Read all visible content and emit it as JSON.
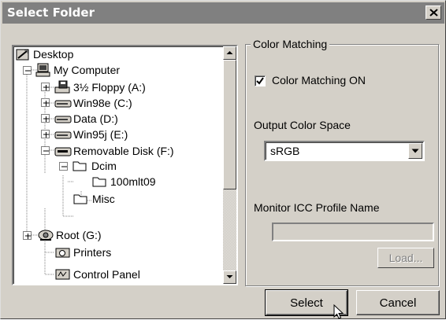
{
  "window": {
    "title": "Select Folder"
  },
  "tree": {
    "nodes": [
      {
        "label": "Desktop",
        "icon": "desktop-icon"
      },
      {
        "label": "My Computer",
        "icon": "computer-icon"
      },
      {
        "label": "3½ Floppy (A:)",
        "icon": "floppy-drive-icon"
      },
      {
        "label": "Win98e (C:)",
        "icon": "hard-drive-icon"
      },
      {
        "label": "Data (D:)",
        "icon": "hard-drive-icon"
      },
      {
        "label": "Win95j (E:)",
        "icon": "hard-drive-icon"
      },
      {
        "label": "Removable Disk (F:)",
        "icon": "removable-disk-icon"
      },
      {
        "label": "Dcim",
        "icon": "folder-open-icon"
      },
      {
        "label": "100mlt09",
        "icon": "folder-icon"
      },
      {
        "label": "Misc",
        "icon": "folder-icon"
      },
      {
        "label": "Root (G:)",
        "icon": "network-drive-icon"
      },
      {
        "label": "Printers",
        "icon": "printers-icon"
      },
      {
        "label": "Control Panel",
        "icon": "control-panel-icon"
      }
    ]
  },
  "color_matching": {
    "group_label": "Color Matching",
    "checkbox_label": "Color Matching ON",
    "checkbox_checked": true,
    "output_color_space_label": "Output Color Space",
    "output_color_space_value": "sRGB",
    "monitor_icc_label": "Monitor ICC Profile Name",
    "monitor_icc_value": "",
    "load_label": "Load..."
  },
  "buttons": {
    "select_label": "Select",
    "cancel_label": "Cancel"
  }
}
